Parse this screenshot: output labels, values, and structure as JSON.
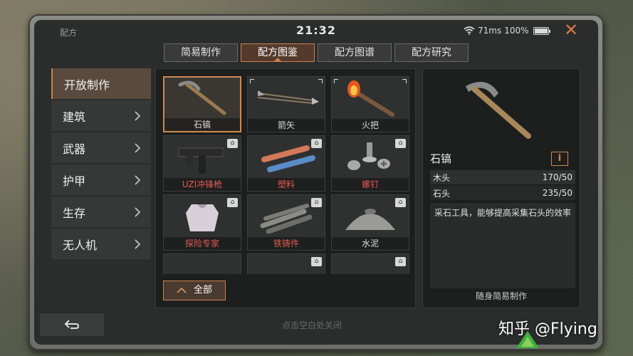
{
  "status": {
    "title": "配方",
    "time": "21:32",
    "ping": "71ms",
    "battery": "100%"
  },
  "tabs": [
    {
      "label": "简易制作",
      "active": false
    },
    {
      "label": "配方图鉴",
      "active": true
    },
    {
      "label": "配方图谱",
      "active": false
    },
    {
      "label": "配方研究",
      "active": false
    }
  ],
  "sidebar": {
    "items": [
      {
        "label": "开放制作"
      },
      {
        "label": "建筑"
      },
      {
        "label": "武器"
      },
      {
        "label": "护甲"
      },
      {
        "label": "生存"
      },
      {
        "label": "无人机"
      }
    ]
  },
  "grid": {
    "items": [
      {
        "label": "石镐",
        "icon": "pickaxe-icon"
      },
      {
        "label": "箭矢",
        "icon": "arrow-icon"
      },
      {
        "label": "火把",
        "icon": "torch-icon"
      },
      {
        "label": "UZI冲锋枪",
        "icon": "uzi-icon"
      },
      {
        "label": "塑料",
        "icon": "plastic-icon"
      },
      {
        "label": "螺钉",
        "icon": "screw-icon"
      },
      {
        "label": "探险专家",
        "icon": "armor-icon"
      },
      {
        "label": "铁铸件",
        "icon": "iron-icon"
      },
      {
        "label": "水泥",
        "icon": "cement-icon"
      }
    ],
    "all_label": "全部"
  },
  "detail": {
    "name": "石镐",
    "info": "i",
    "materials": [
      {
        "name": "木头",
        "amount": "170/50"
      },
      {
        "name": "石头",
        "amount": "235/50"
      }
    ],
    "description": "采石工具，能够提高采集石头的效率",
    "footer": "随身简易制作"
  },
  "bottom_hint": "点击空白处关闭",
  "watermark": "知乎 @Flying",
  "colors": {
    "accent": "#c9824f",
    "locked_text": "#e25a4e"
  }
}
